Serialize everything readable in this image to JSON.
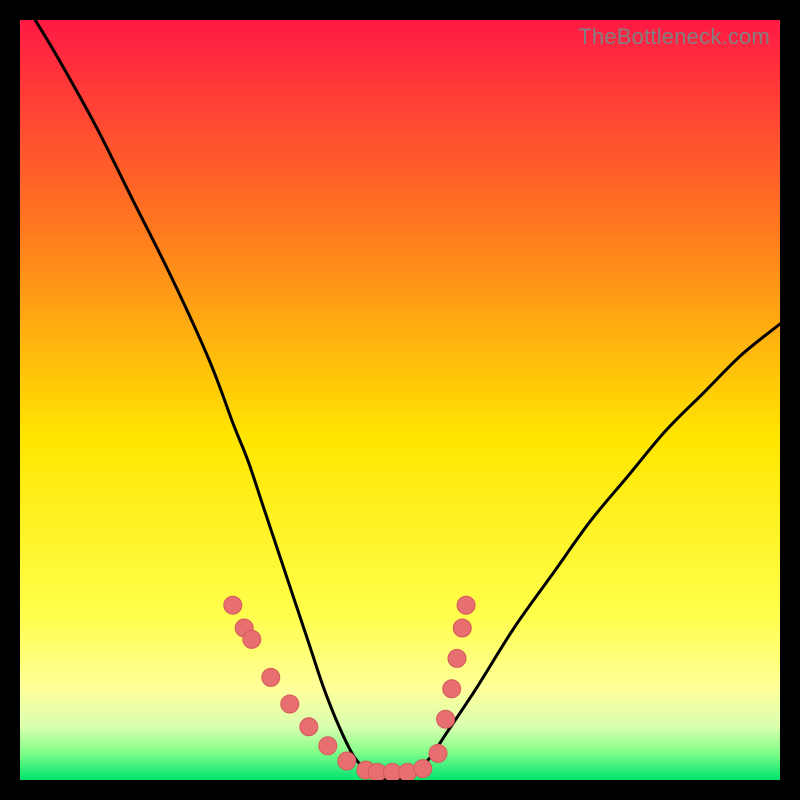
{
  "watermark": "TheBottleneck.com",
  "colors": {
    "frame": "#000000",
    "curve": "#000000",
    "marker_fill": "#e76f6f",
    "marker_stroke": "#d55a5a",
    "gradient_top": "#ff1a44",
    "gradient_mid1": "#ff7b1e",
    "gradient_mid2": "#ffe600",
    "gradient_low": "#ffff9a",
    "gradient_bottom_a": "#8dff8d",
    "gradient_bottom_b": "#00e46e"
  },
  "chart_data": {
    "type": "line",
    "title": "",
    "xlabel": "",
    "ylabel": "",
    "xlim": [
      0,
      100
    ],
    "ylim": [
      0,
      100
    ],
    "grid": false,
    "legend": false,
    "series": [
      {
        "name": "bottleneck-curve",
        "x": [
          2,
          5,
          10,
          15,
          20,
          25,
          28,
          30,
          32,
          34,
          36,
          38,
          40,
          42,
          44,
          46,
          48,
          50,
          52,
          54,
          56,
          60,
          65,
          70,
          75,
          80,
          85,
          90,
          95,
          100
        ],
        "y": [
          100,
          95,
          86,
          76,
          66,
          55,
          47,
          42,
          36,
          30,
          24,
          18,
          12,
          7,
          3,
          1,
          0,
          0,
          1,
          3,
          6,
          12,
          20,
          27,
          34,
          40,
          46,
          51,
          56,
          60
        ]
      }
    ],
    "markers": {
      "name": "highlighted-points",
      "x": [
        28,
        29.5,
        30.5,
        33,
        35.5,
        38,
        40.5,
        43,
        45.5,
        47,
        49,
        51,
        53,
        55,
        56,
        56.8,
        57.5,
        58.2,
        58.7
      ],
      "y": [
        23,
        20,
        18.5,
        13.5,
        10,
        7,
        4.5,
        2.5,
        1.3,
        1,
        1,
        1,
        1.5,
        3.5,
        8,
        12,
        16,
        20,
        23
      ]
    }
  }
}
